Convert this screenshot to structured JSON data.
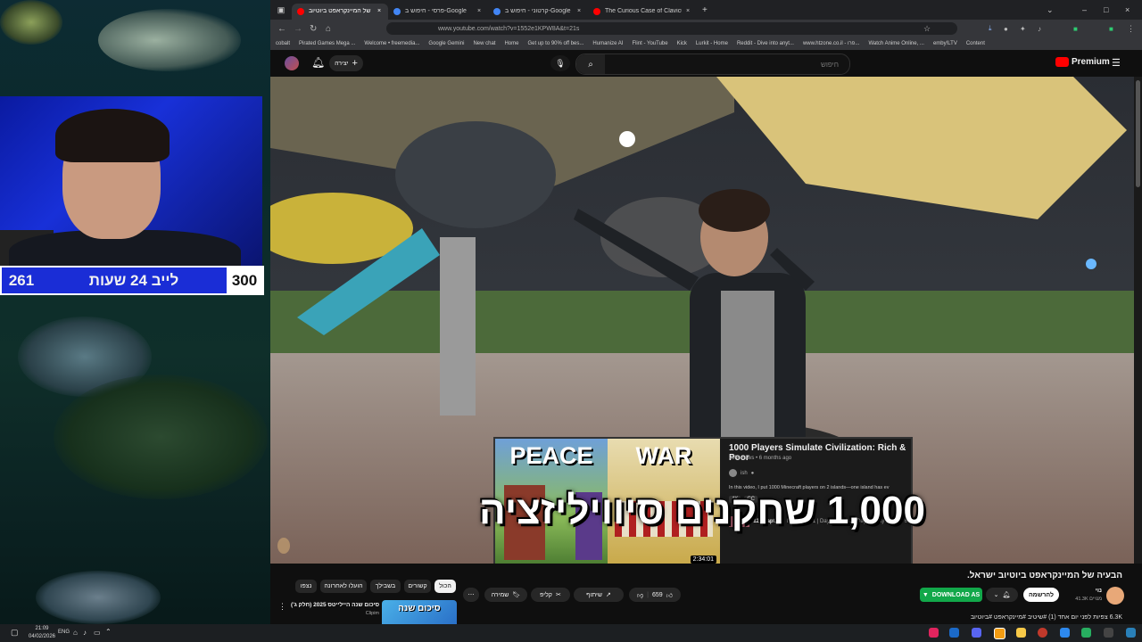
{
  "stream": {
    "counter_left": "261",
    "counter_label": "לייב 24 שעות",
    "counter_right": "300"
  },
  "browser": {
    "tabs": [
      {
        "label": "הבעיה של המיינקראפט ביוטיוב",
        "active": true
      },
      {
        "label": "פרסי - חיפוש ב-Google",
        "active": false
      },
      {
        "label": "קרטוני - חיפוש ב-Google",
        "active": false
      },
      {
        "label": "The Curious Case of Clavicular",
        "active": false
      }
    ],
    "url": "www.youtube.com/watch?v=1552e1KPW8A&t=21s",
    "bookmarks": [
      "cobalt",
      "Pirated Games Mega ...",
      "Welcome • freemedia...",
      "Google Gemini",
      "New chat",
      "Home",
      "Get up to 90% off bes...",
      "Humanize AI",
      "Flint - YouTube",
      "Kick",
      "Lurkit - Home",
      "Reddit - Dive into anyt...",
      "www.htzone.co.il - פרו...",
      "Watch Anime Online, ...",
      "emby!LTV",
      "Content"
    ]
  },
  "youtube": {
    "logo": "Premium",
    "search_placeholder": "חיפוש",
    "create_label": "יצירה",
    "subtitle": "1,000 שחקנים סיוויליזציה",
    "popup": {
      "title": "1000 Players Simulate Civilization: Rich & Poor",
      "meta": "29M views • 6 months ago",
      "channel": "ish",
      "desc": "In this video, I put 1000 Minecraft players on 2 islands—one island has ev",
      "badge1": "4K",
      "badge2": "CC",
      "chapters_label": "12 chapters",
      "chapters": "Intro | Day 1 | Day 2 | Day 3 | Day 4 | Day 5 | Day 6",
      "duration": "2:34:01",
      "thumb_left": "PEACE",
      "thumb_right": "WAR"
    },
    "video_title": "הבעיה של המיינקראפט ביוטיוב ישראל.",
    "channel_name": "נוי",
    "subscribers": "41.3K מנויים",
    "subscribe_label": "להרשמה",
    "download_label": "DOWNLOAD AS",
    "likes": "659",
    "share_label": "שיתוף",
    "clip_label": "קליפ",
    "save_label": "שמירה",
    "views_line": "6.3K צפיות לפני יום אחד (1) #שיטיב #מיינקראפט #ביוטיוב",
    "chips": [
      "הכול",
      "קשורים",
      "בשבילך",
      "הועלו לאחרונה",
      "נצפו"
    ],
    "next_video_title": "סיכום שנה היילייטס 2025 (חלק ג')",
    "next_video_channel": "Clipim",
    "next_video_thumb": "סיכום שנה"
  },
  "taskbar": {
    "time": "21:09",
    "date": "04/02/2026",
    "lang": "ENG"
  }
}
